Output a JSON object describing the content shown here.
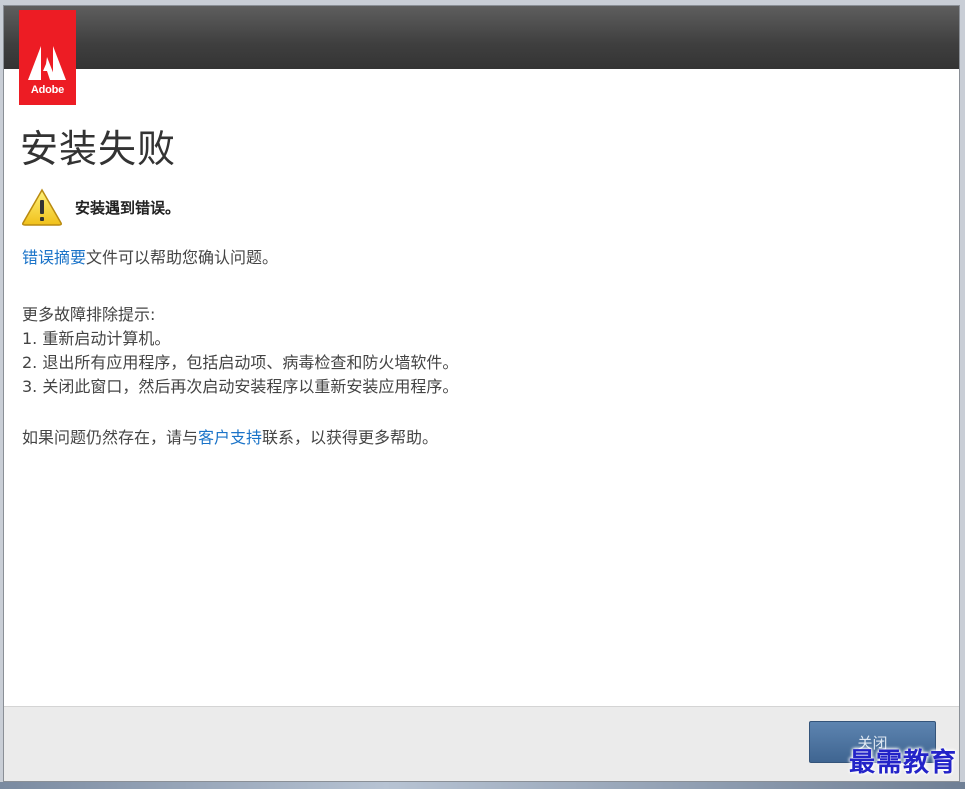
{
  "brand": {
    "logo_text": "Adobe",
    "color": "#ed1c24"
  },
  "page": {
    "title": "安装失败"
  },
  "warning": {
    "icon": "warning-icon",
    "text": "安装遇到错误。"
  },
  "summary": {
    "link_text": "错误摘要",
    "rest_text": "文件可以帮助您确认问题。"
  },
  "tips": {
    "heading": "更多故障排除提示:",
    "items": [
      "1. 重新启动计算机。",
      "2. 退出所有应用程序，包括启动项、病毒检查和防火墙软件。",
      "3. 关闭此窗口，然后再次启动安装程序以重新安装应用程序。"
    ]
  },
  "contact": {
    "before": "如果问题仍然存在，请与",
    "link_text": "客户支持",
    "after": "联系，以获得更多帮助。"
  },
  "footer": {
    "close_label": "关闭"
  },
  "watermark": {
    "text": "最需教育"
  },
  "colors": {
    "link": "#1a73c8",
    "titlebar": "#3f3f3f",
    "button": "#4a6f9a"
  }
}
